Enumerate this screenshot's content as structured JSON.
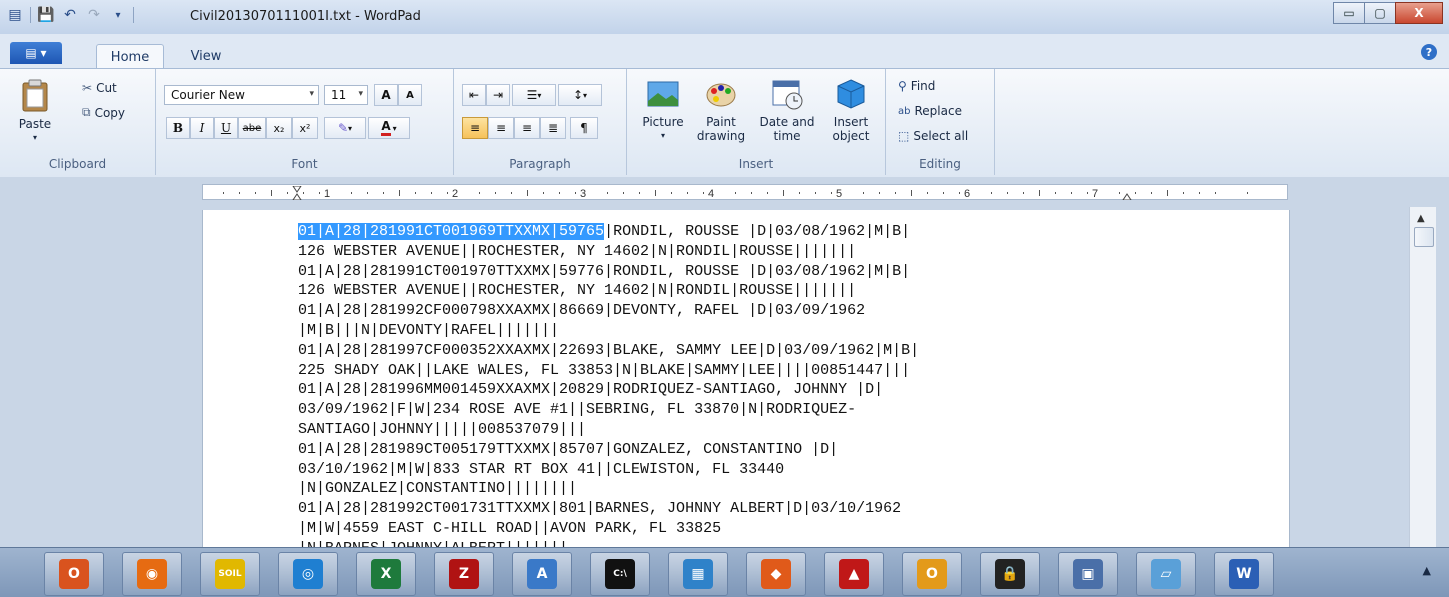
{
  "window": {
    "title": "Civil2013070111001I.txt - WordPad",
    "buttons": [
      "▭",
      "▢",
      "X"
    ]
  },
  "tabs": {
    "file_glyph": "▤ ▾",
    "home": "Home",
    "view": "View",
    "help": "?"
  },
  "clipboard": {
    "group": "Clipboard",
    "paste": "Paste",
    "cut": "Cut",
    "copy": "Copy"
  },
  "font": {
    "group": "Font",
    "family": "Courier New",
    "size": "11",
    "grow": "A",
    "shrink": "A",
    "bold": "B",
    "italic": "I",
    "underline": "U",
    "strike": "abe",
    "subscript": "x₂",
    "superscript": "x²",
    "color_a": "A"
  },
  "paragraph": {
    "group": "Paragraph"
  },
  "insert": {
    "group": "Insert",
    "picture": "Picture",
    "paint": "Paint drawing",
    "datetime": "Date and time",
    "object": "Insert object"
  },
  "editing": {
    "group": "Editing",
    "find": "Find",
    "replace": "Replace",
    "selectall": "Select all"
  },
  "ruler": {
    "marks": [
      "1",
      "2",
      "3",
      "4",
      "5",
      "6",
      "7"
    ]
  },
  "document": {
    "selected": "01|A|28|281991CT001969TTXXMX|59765",
    "first_rest": "|RONDIL, ROUSSE |D|03/08/1962|M|B|",
    "lines": [
      "126 WEBSTER AVENUE||ROCHESTER, NY 14602|N|RONDIL|ROUSSE|||||||",
      "01|A|28|281991CT001970TTXXMX|59776|RONDIL, ROUSSE |D|03/08/1962|M|B|",
      "126 WEBSTER AVENUE||ROCHESTER, NY 14602|N|RONDIL|ROUSSE|||||||",
      "01|A|28|281992CF000798XXAXMX|86669|DEVONTY, RAFEL |D|03/09/1962",
      "|M|B|||N|DEVONTY|RAFEL|||||||",
      "01|A|28|281997CF000352XXAXMX|22693|BLAKE, SAMMY LEE|D|03/09/1962|M|B|",
      "225 SHADY OAK||LAKE WALES, FL 33853|N|BLAKE|SAMMY|LEE||||00851447|||",
      "01|A|28|281996MM001459XXAXMX|20829|RODRIQUEZ-SANTIAGO, JOHNNY |D|",
      "03/09/1962|F|W|234 ROSE AVE #1||SEBRING, FL 33870|N|RODRIQUEZ-",
      "SANTIAGO|JOHNNY|||||008537079|||",
      "01|A|28|281989CT005179TTXXMX|85707|GONZALEZ, CONSTANTINO |D|",
      "03/10/1962|M|W|833 STAR RT BOX 41||CLEWISTON, FL 33440",
      "|N|GONZALEZ|CONSTANTINO||||||||",
      "01|A|28|281992CT001731TTXXMX|801|BARNES, JOHNNY ALBERT|D|03/10/1962",
      "|M|W|4559 EAST C-HILL ROAD||AVON PARK, FL 33825",
      "|N|BARNES|JOHNNY|ALBERT|||||||"
    ]
  },
  "taskbar": {
    "items": [
      {
        "name": "outlook",
        "glyph": "O",
        "color": "#d9531e"
      },
      {
        "name": "firefox",
        "glyph": "◉",
        "color": "#e66b12"
      },
      {
        "name": "soil",
        "glyph": "SOIL",
        "color": "#e1b800"
      },
      {
        "name": "chat",
        "glyph": "◎",
        "color": "#1f7fd1"
      },
      {
        "name": "excel",
        "glyph": "X",
        "color": "#1e7a3c"
      },
      {
        "name": "filezilla",
        "glyph": "Z",
        "color": "#b01313"
      },
      {
        "name": "wordpad",
        "glyph": "A",
        "color": "#3a79c8"
      },
      {
        "name": "cmd",
        "glyph": "C:\\",
        "color": "#111111"
      },
      {
        "name": "control-panel",
        "glyph": "▦",
        "color": "#2f82c9"
      },
      {
        "name": "office",
        "glyph": "◆",
        "color": "#e05a1a"
      },
      {
        "name": "acrobat",
        "glyph": "▲",
        "color": "#c01818"
      },
      {
        "name": "outlook2",
        "glyph": "O",
        "color": "#e39a1a"
      },
      {
        "name": "lock",
        "glyph": "🔒",
        "color": "#222222"
      },
      {
        "name": "network",
        "glyph": "▣",
        "color": "#4a6fa8"
      },
      {
        "name": "notepad",
        "glyph": "▱",
        "color": "#5aa0d8"
      },
      {
        "name": "word",
        "glyph": "W",
        "color": "#2b5fb5"
      }
    ],
    "tray": "▲"
  }
}
